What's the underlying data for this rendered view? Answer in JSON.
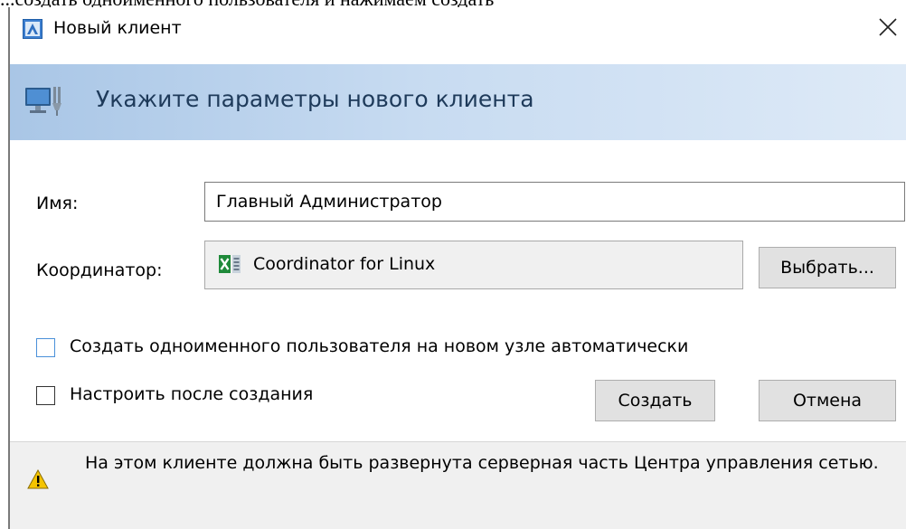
{
  "background_text": "...создать одноименного пользователя и нажимаем создать",
  "window": {
    "title": "Новый клиент",
    "app_icon": "app-icon",
    "close_icon": "close-icon"
  },
  "header": {
    "icon": "network-computer-icon",
    "text": "Укажите параметры нового клиента"
  },
  "form": {
    "name_label": "Имя:",
    "name_value": "Главный Администратор",
    "coordinator_label": "Координатор:",
    "coordinator_icon": "coordinator-icon",
    "coordinator_value": "Coordinator for Linux",
    "select_button": "Выбрать..."
  },
  "options": {
    "create_user_label": "Создать одноименного пользователя на новом узле автоматически",
    "create_user_checked": false,
    "configure_after_label": "Настроить после создания",
    "configure_after_checked": false
  },
  "actions": {
    "create_button": "Создать",
    "cancel_button": "Отмена"
  },
  "footer": {
    "warning_icon": "warning-icon",
    "warning_text": "На этом клиенте должна быть развернута серверная часть Центра управления сетью."
  },
  "colors": {
    "header_gradient_start": "#a9c6e6",
    "header_gradient_end": "#deeaf7",
    "header_text": "#1e3a5a",
    "button_bg": "#e1e1e1",
    "footer_bg": "#f0f0f0",
    "warning_yellow": "#f5c400"
  }
}
